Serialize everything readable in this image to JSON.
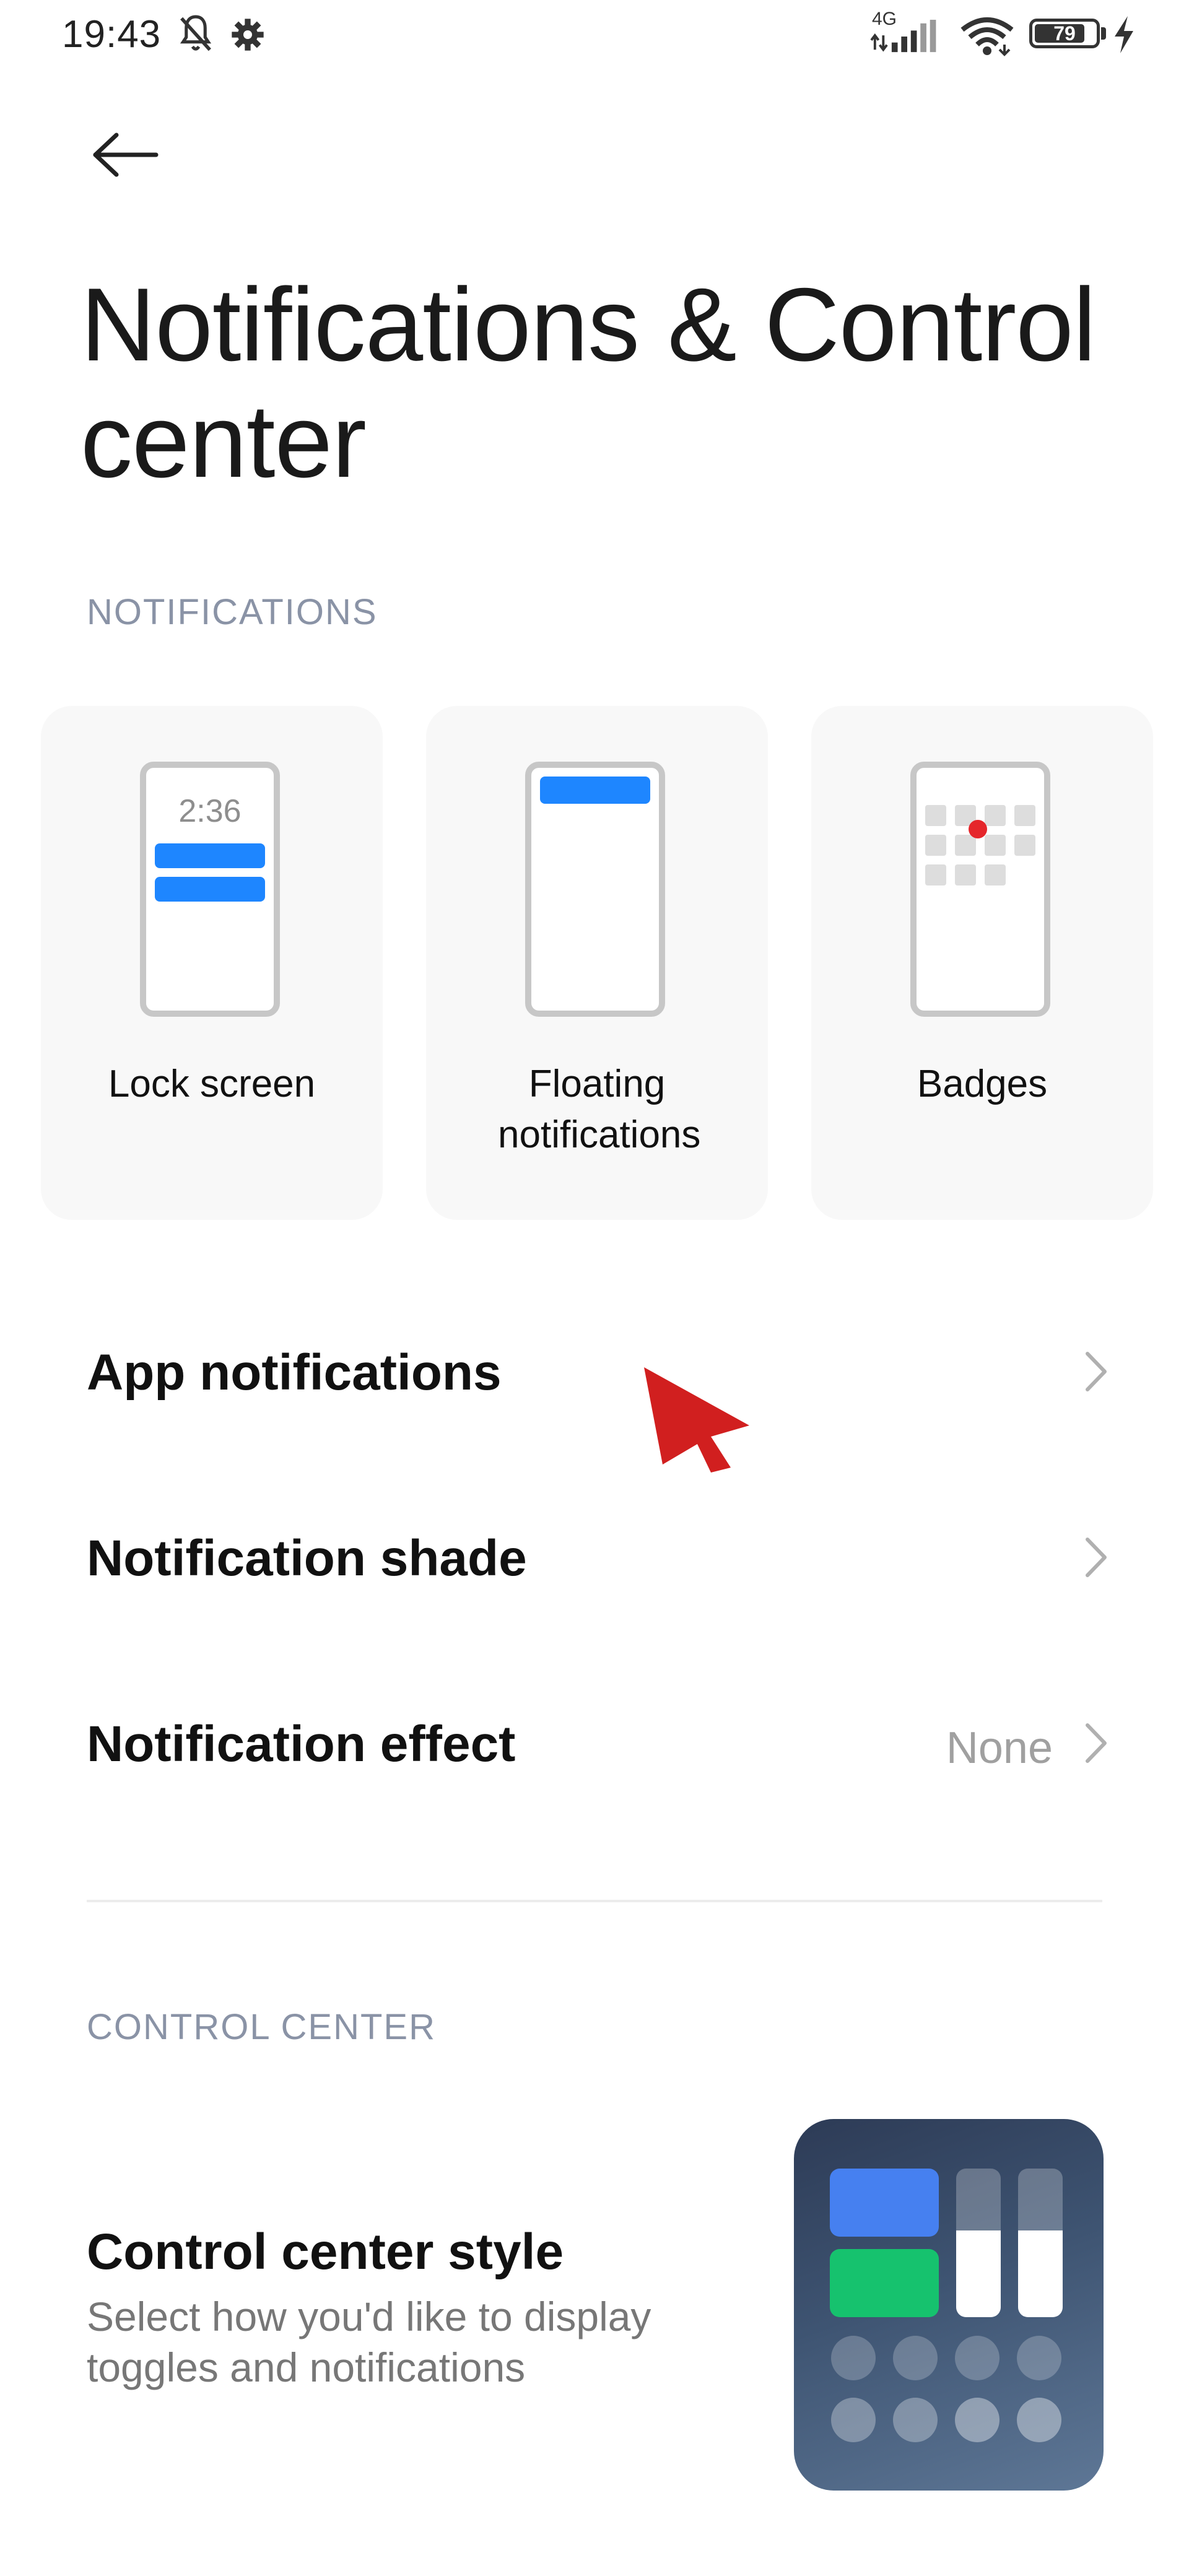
{
  "status_bar": {
    "time": "19:43",
    "network": "4G",
    "battery": "79",
    "icons": [
      "bell-off-icon",
      "gear-icon",
      "signal-icon",
      "wifi-icon",
      "battery-icon",
      "charging-icon"
    ]
  },
  "header": {
    "back_icon": "arrow-left-icon",
    "title": "Notifications & Control center"
  },
  "notifications": {
    "section_title": "NOTIFICATIONS",
    "cards": [
      {
        "label": "Lock screen",
        "preview_time": "2:36"
      },
      {
        "label": "Floating notifications"
      },
      {
        "label": "Badges"
      }
    ],
    "rows": [
      {
        "label": "App notifications",
        "value": ""
      },
      {
        "label": "Notification shade",
        "value": ""
      },
      {
        "label": "Notification effect",
        "value": "None"
      }
    ]
  },
  "control_center": {
    "section_title": "CONTROL CENTER",
    "style_title": "Control center style",
    "style_subtitle": "Select how you'd like to display toggles and notifications"
  },
  "colors": {
    "accent_blue": "#1e86ff",
    "badge_red": "#e5262b",
    "cursor_red": "#d11f1f",
    "section_header": "#8a93a6",
    "value_gray": "#a0a0a0"
  }
}
